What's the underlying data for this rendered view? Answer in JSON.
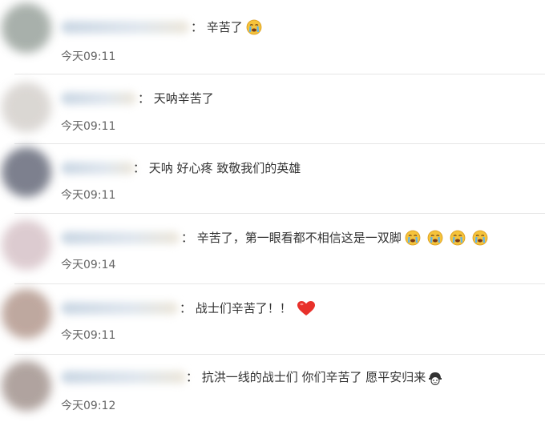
{
  "comments": [
    {
      "text": "：  辛苦了",
      "time": "今天09:11",
      "emojis": [
        "crying-face-icon"
      ],
      "avatar_color": "#9fa8a2"
    },
    {
      "text": "：  天呐辛苦了",
      "time": "今天09:11",
      "emojis": [],
      "avatar_color": "#d7d3cf"
    },
    {
      "text": "：  天呐 好心疼 致敬我们的英雄",
      "time": "今天09:11",
      "emojis": [],
      "avatar_color": "#6f7382"
    },
    {
      "text": "：  辛苦了，第一眼看都不相信这是一双脚",
      "time": "今天09:14",
      "emojis": [
        "crying-face-icon",
        "crying-face-icon",
        "crying-face-icon",
        "crying-face-icon"
      ],
      "avatar_color": "#d9c6cb"
    },
    {
      "text": "：  战士们辛苦了！！",
      "time": "今天09:11",
      "emojis": [
        "red-heart-icon"
      ],
      "avatar_color": "#b89f95"
    },
    {
      "text": "：  抗洪一线的战士们 你们辛苦了 愿平安归来",
      "time": "今天09:12",
      "emojis": [
        "salute-icon"
      ],
      "avatar_color": "#a89a95"
    }
  ]
}
